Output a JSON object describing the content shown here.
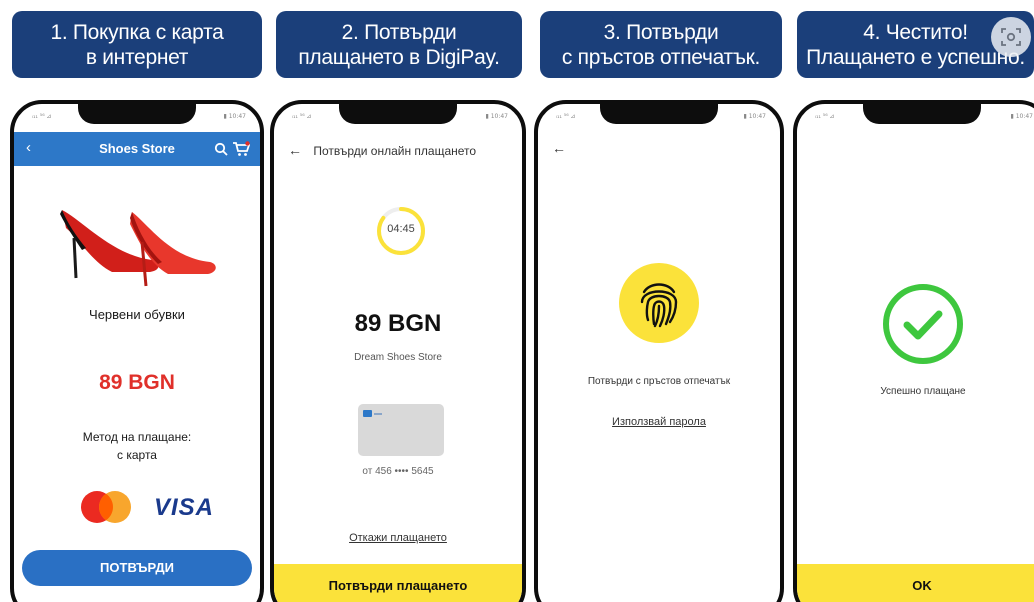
{
  "steps": [
    {
      "line1": "1. Покупка с карта",
      "line2": "в интернет"
    },
    {
      "line1": "2. Потвърди",
      "line2": "плащането в DigiPay."
    },
    {
      "line1": "3. Потвърди",
      "line2": "с пръстов отпечатък."
    },
    {
      "line1": "4. Честито!",
      "line2": "Плащането е успешно."
    }
  ],
  "status_bar": {
    "left": "ᵢ₁₁ ⁵⁶ ⊿",
    "right": "▮ 10:47"
  },
  "screen1": {
    "store_title": "Shoes Store",
    "product_name": "Червени обувки",
    "price": "89 BGN",
    "payment_method_line1": "Метод на плащане:",
    "payment_method_line2": "с карта",
    "visa": "VISA",
    "confirm_button": "ПОТВЪРДИ"
  },
  "screen2": {
    "header": "Потвърди онлайн плащането",
    "timer": "04:45",
    "timer_progress": 0.85,
    "amount": "89 BGN",
    "merchant": "Dream Shoes Store",
    "card_number": "от 456 •••• 5645",
    "cancel_link": "Откажи плащането",
    "confirm_button": "Потвърди плащането"
  },
  "screen3": {
    "prompt": "Потвърди с пръстов отпечатък",
    "use_password_link": "Използвай парола"
  },
  "screen4": {
    "success_text": "Успешно плащане",
    "ok_button": "OK"
  },
  "colors": {
    "banner": "#1b3f7a",
    "app_blue": "#2d78c8",
    "yellow": "#fbe23a",
    "success_green": "#3ec73e",
    "price_red": "#e0302a"
  }
}
